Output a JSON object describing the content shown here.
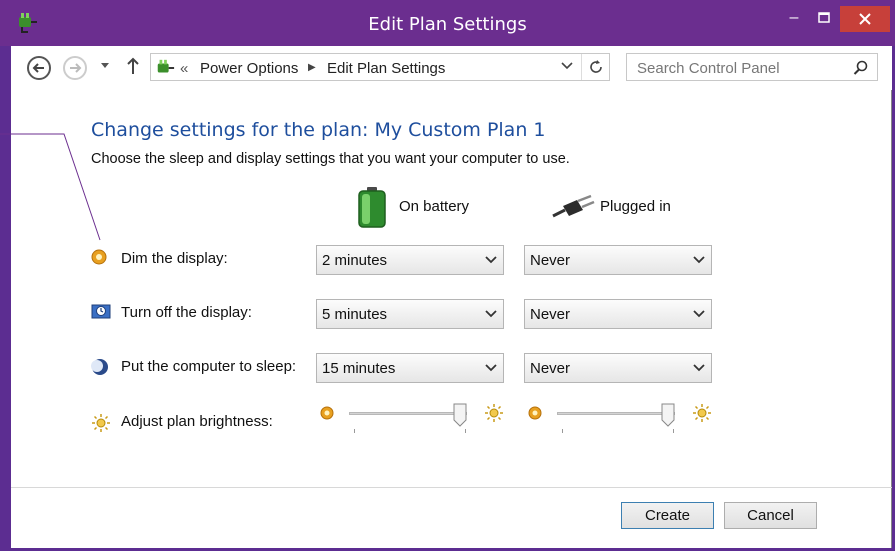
{
  "window": {
    "title": "Edit Plan Settings"
  },
  "nav": {
    "crumb_chevrons": "«",
    "crumbs": [
      "Power Options",
      "Edit Plan Settings"
    ],
    "search_placeholder": "Search Control Panel"
  },
  "main": {
    "heading": "Change settings for the plan: My Custom Plan 1",
    "description": "Choose the sleep and display settings that you want your computer to use.",
    "columns": {
      "battery": "On battery",
      "plugged": "Plugged in"
    },
    "rows": [
      {
        "label": "Dim the display:",
        "battery": "2 minutes",
        "plugged": "Never"
      },
      {
        "label": "Turn off the display:",
        "battery": "5 minutes",
        "plugged": "Never"
      },
      {
        "label": "Put the computer to sleep:",
        "battery": "15 minutes",
        "plugged": "Never"
      },
      {
        "label": "Adjust plan brightness:",
        "battery_level_percent": 100,
        "plugged_level_percent": 100
      }
    ]
  },
  "footer": {
    "create": "Create",
    "cancel": "Cancel"
  },
  "colors": {
    "titlebar": "#6b2e8f",
    "close": "#c7403a",
    "heading": "#1e4e9d"
  }
}
